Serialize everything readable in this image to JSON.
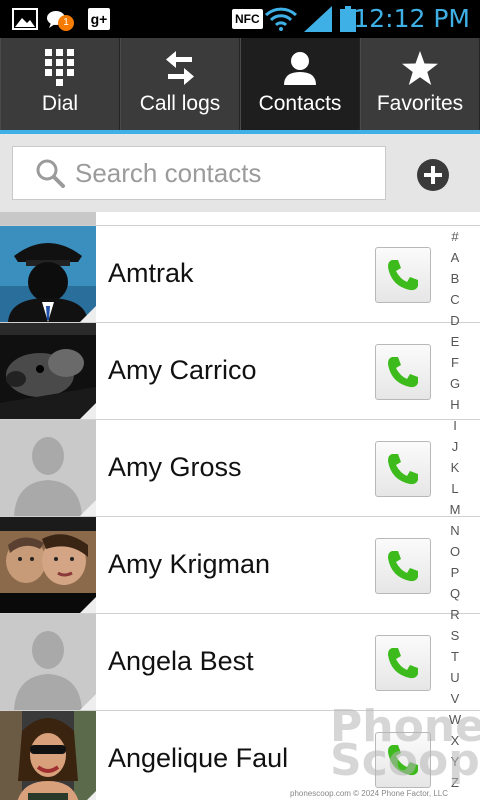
{
  "status_bar": {
    "time": "12:12 PM",
    "nfc_label": "NFC",
    "gplus_label": "g+",
    "badge_count": "1",
    "icons": [
      "gallery-icon",
      "chat-icon",
      "google-plus-icon",
      "nfc-icon",
      "wifi-icon",
      "signal-icon",
      "battery-icon"
    ]
  },
  "tabs": [
    {
      "label": "Dial",
      "icon": "dialpad-icon",
      "active": false
    },
    {
      "label": "Call logs",
      "icon": "arrows-icon",
      "active": false
    },
    {
      "label": "Contacts",
      "icon": "person-icon",
      "active": true
    },
    {
      "label": "Favorites",
      "icon": "star-icon",
      "active": false
    }
  ],
  "search": {
    "placeholder": "Search contacts"
  },
  "contacts": [
    {
      "name": "Amtrak",
      "avatar": "photo"
    },
    {
      "name": "Amy Carrico",
      "avatar": "photo"
    },
    {
      "name": "Amy Gross",
      "avatar": "placeholder"
    },
    {
      "name": "Amy Krigman",
      "avatar": "photo"
    },
    {
      "name": "Angela Best",
      "avatar": "placeholder"
    },
    {
      "name": "Angelique Faul",
      "avatar": "photo"
    }
  ],
  "index_letters": [
    "#",
    "A",
    "B",
    "C",
    "D",
    "E",
    "F",
    "G",
    "H",
    "I",
    "J",
    "K",
    "L",
    "M",
    "N",
    "O",
    "P",
    "Q",
    "R",
    "S",
    "T",
    "U",
    "V",
    "W",
    "X",
    "Y",
    "Z"
  ],
  "watermark": {
    "line1": "Phone",
    "line2": "Scoop"
  },
  "footer": "phonescoop.com   © 2024 Phone Factor, LLC",
  "colors": {
    "accent": "#3fb0e6",
    "call_green": "#3dbb1c",
    "tab_bg": "#3b3b3b"
  }
}
